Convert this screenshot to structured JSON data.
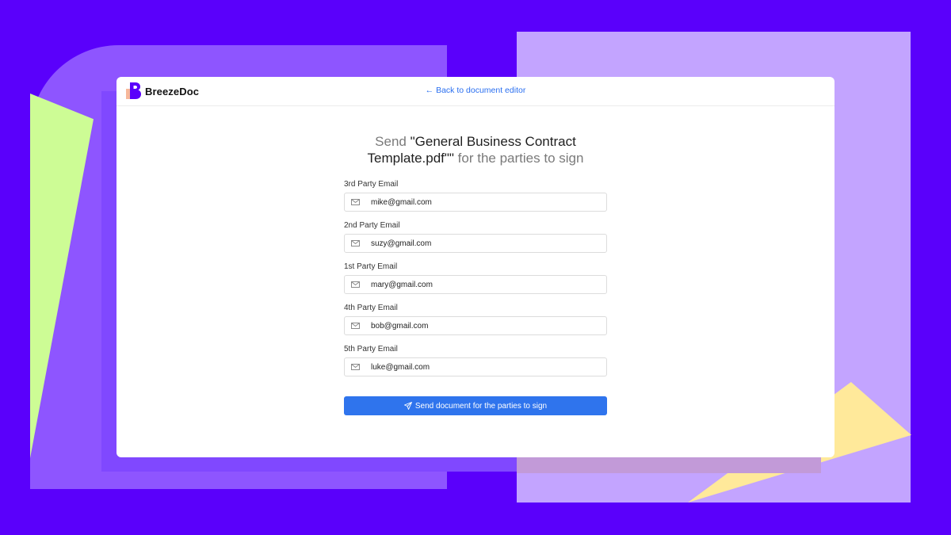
{
  "app": {
    "brand": "BreezeDoc"
  },
  "header": {
    "back_link": "← Back to document editor"
  },
  "main": {
    "title_prefix": "Send ",
    "title_document": "\"General Business Contract Template.pdf\"\"",
    "title_suffix": " for the parties to sign",
    "fields": [
      {
        "label": "3rd Party Email",
        "value": "mike@gmail.com"
      },
      {
        "label": "2nd Party Email",
        "value": "suzy@gmail.com"
      },
      {
        "label": "1st Party Email",
        "value": "mary@gmail.com"
      },
      {
        "label": "4th Party Email",
        "value": "bob@gmail.com"
      },
      {
        "label": "5th Party Email",
        "value": "luke@gmail.com"
      }
    ],
    "send_button": "Send document for the parties to sign"
  },
  "icons": {
    "field_icon": "mail-icon",
    "button_icon": "send-icon"
  },
  "colors": {
    "background": "#5a00fb",
    "accent": "#2f74ed",
    "link": "#2a6ff0"
  }
}
